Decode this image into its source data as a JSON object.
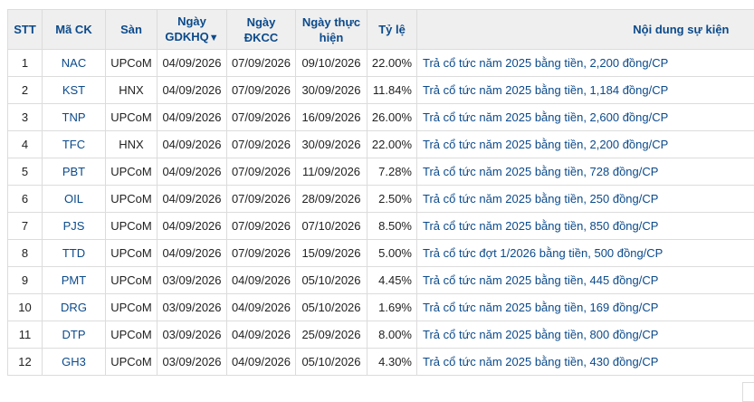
{
  "headers": {
    "stt": "STT",
    "ticker": "Mã CK",
    "exchange": "Sàn",
    "exdate_line1": "Ngày",
    "exdate_line2": "GDKHQ",
    "exdate_sort": "▼",
    "recdate_line1": "Ngày",
    "recdate_line2": "ĐKCC",
    "paydate_line1": "Ngày thực",
    "paydate_line2": "hiện",
    "ratio": "Tỷ lệ",
    "content": "Nội dung sự kiện"
  },
  "rows": [
    {
      "stt": "1",
      "ticker": "NAC",
      "exchange": "UPCoM",
      "exdate": "04/09/2026",
      "recdate": "07/09/2026",
      "paydate": "09/10/2026",
      "ratio": "22.00%",
      "event": "Trả cổ tức năm 2025 bằng tiền, 2,200 đồng/CP"
    },
    {
      "stt": "2",
      "ticker": "KST",
      "exchange": "HNX",
      "exdate": "04/09/2026",
      "recdate": "07/09/2026",
      "paydate": "30/09/2026",
      "ratio": "11.84%",
      "event": "Trả cổ tức năm 2025 bằng tiền, 1,184 đồng/CP"
    },
    {
      "stt": "3",
      "ticker": "TNP",
      "exchange": "UPCoM",
      "exdate": "04/09/2026",
      "recdate": "07/09/2026",
      "paydate": "16/09/2026",
      "ratio": "26.00%",
      "event": "Trả cổ tức năm 2025 bằng tiền, 2,600 đồng/CP"
    },
    {
      "stt": "4",
      "ticker": "TFC",
      "exchange": "HNX",
      "exdate": "04/09/2026",
      "recdate": "07/09/2026",
      "paydate": "30/09/2026",
      "ratio": "22.00%",
      "event": "Trả cổ tức năm 2025 bằng tiền, 2,200 đồng/CP"
    },
    {
      "stt": "5",
      "ticker": "PBT",
      "exchange": "UPCoM",
      "exdate": "04/09/2026",
      "recdate": "07/09/2026",
      "paydate": "11/09/2026",
      "ratio": "7.28%",
      "event": "Trả cổ tức năm 2025 bằng tiền, 728 đồng/CP"
    },
    {
      "stt": "6",
      "ticker": "OIL",
      "exchange": "UPCoM",
      "exdate": "04/09/2026",
      "recdate": "07/09/2026",
      "paydate": "28/09/2026",
      "ratio": "2.50%",
      "event": "Trả cổ tức năm 2025 bằng tiền, 250 đồng/CP"
    },
    {
      "stt": "7",
      "ticker": "PJS",
      "exchange": "UPCoM",
      "exdate": "04/09/2026",
      "recdate": "07/09/2026",
      "paydate": "07/10/2026",
      "ratio": "8.50%",
      "event": "Trả cổ tức năm 2025 bằng tiền, 850 đồng/CP"
    },
    {
      "stt": "8",
      "ticker": "TTD",
      "exchange": "UPCoM",
      "exdate": "04/09/2026",
      "recdate": "07/09/2026",
      "paydate": "15/09/2026",
      "ratio": "5.00%",
      "event": "Trả cổ tức đợt 1/2026 bằng tiền, 500 đồng/CP"
    },
    {
      "stt": "9",
      "ticker": "PMT",
      "exchange": "UPCoM",
      "exdate": "03/09/2026",
      "recdate": "04/09/2026",
      "paydate": "05/10/2026",
      "ratio": "4.45%",
      "event": "Trả cổ tức năm 2025 bằng tiền, 445 đồng/CP"
    },
    {
      "stt": "10",
      "ticker": "DRG",
      "exchange": "UPCoM",
      "exdate": "03/09/2026",
      "recdate": "04/09/2026",
      "paydate": "05/10/2026",
      "ratio": "1.69%",
      "event": "Trả cổ tức năm 2025 bằng tiền, 169 đồng/CP"
    },
    {
      "stt": "11",
      "ticker": "DTP",
      "exchange": "UPCoM",
      "exdate": "03/09/2026",
      "recdate": "04/09/2026",
      "paydate": "25/09/2026",
      "ratio": "8.00%",
      "event": "Trả cổ tức năm 2025 bằng tiền, 800 đồng/CP"
    },
    {
      "stt": "12",
      "ticker": "GH3",
      "exchange": "UPCoM",
      "exdate": "03/09/2026",
      "recdate": "04/09/2026",
      "paydate": "05/10/2026",
      "ratio": "4.30%",
      "event": "Trả cổ tức năm 2025 bằng tiền, 430 đồng/CP"
    }
  ]
}
